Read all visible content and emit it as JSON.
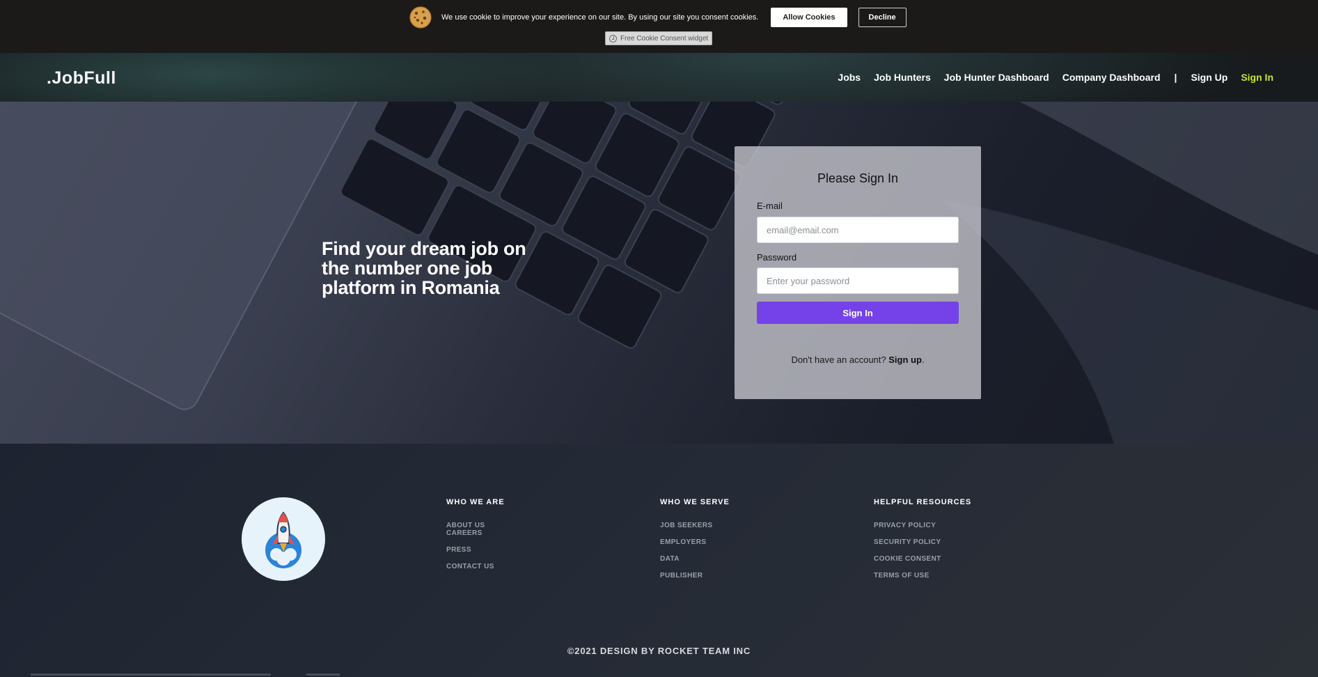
{
  "cookie": {
    "icon": "cookie-icon",
    "message": "We use cookie to improve your experience on our site. By using our site you consent cookies.",
    "allow_label": "Allow Cookies",
    "decline_label": "Decline",
    "widget_label": "Free Cookie Consent widget"
  },
  "navbar": {
    "brand": ".JobFull",
    "links": [
      "Jobs",
      "Job Hunters",
      "Job Hunter Dashboard",
      "Company Dashboard"
    ],
    "separator": "|",
    "signup_label": "Sign Up",
    "signin_label": "Sign In",
    "active_color": "#cbe43a"
  },
  "hero": {
    "headline": "Find your dream job on the number one job platform in Romania"
  },
  "signin": {
    "title": "Please Sign In",
    "email_label": "E-mail",
    "email_placeholder": "email@email.com",
    "password_label": "Password",
    "password_placeholder": "Enter your password",
    "submit_label": "Sign In",
    "no_account_text": "Don't have an account?",
    "signup_link": "Sign up",
    "button_color": "#7442e8"
  },
  "footer": {
    "logo_icon": "rocket-icon",
    "columns": [
      {
        "heading": "WHO WE ARE",
        "links": [
          "ABOUT US",
          "CAREERS",
          "PRESS",
          "CONTACT US"
        ]
      },
      {
        "heading": "WHO WE SERVE",
        "links": [
          "JOB SEEKERS",
          "EMPLOYERS",
          "DATA",
          "PUBLISHER"
        ]
      },
      {
        "heading": "HELPFUL RESOURCES",
        "links": [
          "PRIVACY POLICY",
          "SECURITY POLICY",
          "COOKIE CONSENT",
          "TERMS OF USE"
        ]
      }
    ],
    "copyright": "©2021 DESIGN BY ROCKET TEAM INC"
  }
}
